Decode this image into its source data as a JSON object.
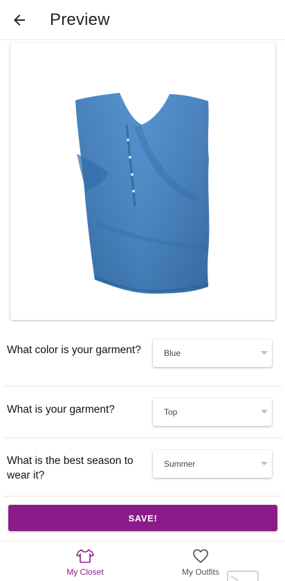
{
  "appbar": {
    "title": "Preview"
  },
  "questions": [
    {
      "label": "What color is your garment?",
      "value": "Blue"
    },
    {
      "label": "What is your garment?",
      "value": "Top"
    },
    {
      "label": "What is the best season to wear it?",
      "value": "Summer"
    }
  ],
  "save_button": {
    "label": "SAVE!"
  },
  "bottom_nav": {
    "items": [
      {
        "label": "My Closet",
        "icon": "shirt-icon",
        "active": true
      },
      {
        "label": "My Outfits",
        "icon": "heart-icon",
        "active": false
      }
    ]
  },
  "colors": {
    "accent": "#8b1b88",
    "garment": "#3f7fc0"
  }
}
